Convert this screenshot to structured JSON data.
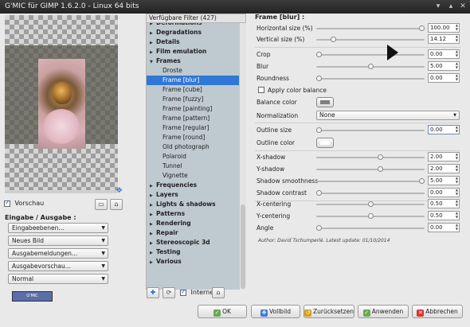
{
  "window": {
    "title": "G'MIC für GIMP 1.6.2.0 - Linux 64 bits"
  },
  "preview": {
    "vorschau_label": "Vorschau",
    "vorschau_checked": true
  },
  "io": {
    "title": "Eingabe / Ausgabe :",
    "combos": [
      "Eingabeebenen...",
      "Neues Bild",
      "Ausgabemeldungen...",
      "Ausgabevorschau...",
      "Normal"
    ],
    "logo_text": "G'MIC"
  },
  "filters": {
    "header": "Verfügbare Filter (427)",
    "rows": [
      {
        "label": "Deformations",
        "kind": "cat",
        "open": false
      },
      {
        "label": "Degradations",
        "kind": "cat",
        "open": false
      },
      {
        "label": "Details",
        "kind": "cat",
        "open": false
      },
      {
        "label": "Film emulation",
        "kind": "cat",
        "open": false
      },
      {
        "label": "Frames",
        "kind": "cat",
        "open": true
      },
      {
        "label": "Droste",
        "kind": "leaf"
      },
      {
        "label": "Frame [blur]",
        "kind": "leaf",
        "selected": true
      },
      {
        "label": "Frame [cube]",
        "kind": "leaf"
      },
      {
        "label": "Frame [fuzzy]",
        "kind": "leaf"
      },
      {
        "label": "Frame [painting]",
        "kind": "leaf"
      },
      {
        "label": "Frame [pattern]",
        "kind": "leaf"
      },
      {
        "label": "Frame [regular]",
        "kind": "leaf"
      },
      {
        "label": "Frame [round]",
        "kind": "leaf"
      },
      {
        "label": "Old photograph",
        "kind": "leaf"
      },
      {
        "label": "Polaroid",
        "kind": "leaf"
      },
      {
        "label": "Tunnel",
        "kind": "leaf"
      },
      {
        "label": "Vignette",
        "kind": "leaf"
      },
      {
        "label": "Frequencies",
        "kind": "cat",
        "open": false
      },
      {
        "label": "Layers",
        "kind": "cat",
        "open": false
      },
      {
        "label": "Lights & shadows",
        "kind": "cat",
        "open": false
      },
      {
        "label": "Patterns",
        "kind": "cat",
        "open": false
      },
      {
        "label": "Rendering",
        "kind": "cat",
        "open": false
      },
      {
        "label": "Repair",
        "kind": "cat",
        "open": false
      },
      {
        "label": "Stereoscopic 3d",
        "kind": "cat",
        "open": false
      },
      {
        "label": "Testing",
        "kind": "cat",
        "open": false
      },
      {
        "label": "Various",
        "kind": "cat",
        "open": false
      }
    ],
    "internet_label": "Internet",
    "internet_checked": true
  },
  "params": {
    "title": "Frame [blur] :",
    "horizontal_size": {
      "label": "Horizontal size (%)",
      "value": "100.00",
      "fraction": 1.0
    },
    "vertical_size": {
      "label": "Vertical size (%)",
      "value": "14.12",
      "fraction": 0.14
    },
    "crop": {
      "label": "Crop",
      "value": "0.00",
      "fraction": 0.0
    },
    "blur": {
      "label": "Blur",
      "value": "5.00",
      "fraction": 0.5
    },
    "roundness": {
      "label": "Roundness",
      "value": "0.00",
      "fraction": 0.0
    },
    "apply_color_balance": {
      "label": "Apply color balance",
      "checked": false
    },
    "balance_color": {
      "label": "Balance color",
      "color": "#7f7f7f"
    },
    "normalization": {
      "label": "Normalization",
      "value": "None"
    },
    "outline_size": {
      "label": "Outline size",
      "value": "0.00",
      "fraction": 0.0
    },
    "outline_color": {
      "label": "Outline color",
      "color": "#ffffff"
    },
    "x_shadow": {
      "label": "X-shadow",
      "value": "2.00",
      "fraction": 0.6
    },
    "y_shadow": {
      "label": "Y-shadow",
      "value": "2.00",
      "fraction": 0.6
    },
    "shadow_smoothness": {
      "label": "Shadow smoothness",
      "value": "5.00",
      "fraction": 1.0
    },
    "shadow_contrast": {
      "label": "Shadow contrast",
      "value": "0.00",
      "fraction": 0.0
    },
    "x_centering": {
      "label": "X-centering",
      "value": "0.50",
      "fraction": 0.5
    },
    "y_centering": {
      "label": "Y-centering",
      "value": "0.50",
      "fraction": 0.5
    },
    "angle": {
      "label": "Angle",
      "value": "0.00",
      "fraction": 0.0
    },
    "author": "Author: David Tschumperlé.     Latest update: 01/10/2014"
  },
  "buttons": {
    "ok": "OK",
    "vollbild": "Vollbild",
    "zuruecksetzen": "Zurücksetzen",
    "anwenden": "Anwenden",
    "abbrechen": "Abbrechen"
  },
  "colors": {
    "selection": "#2f78d7",
    "tree_bg": "#bfc9d0"
  }
}
